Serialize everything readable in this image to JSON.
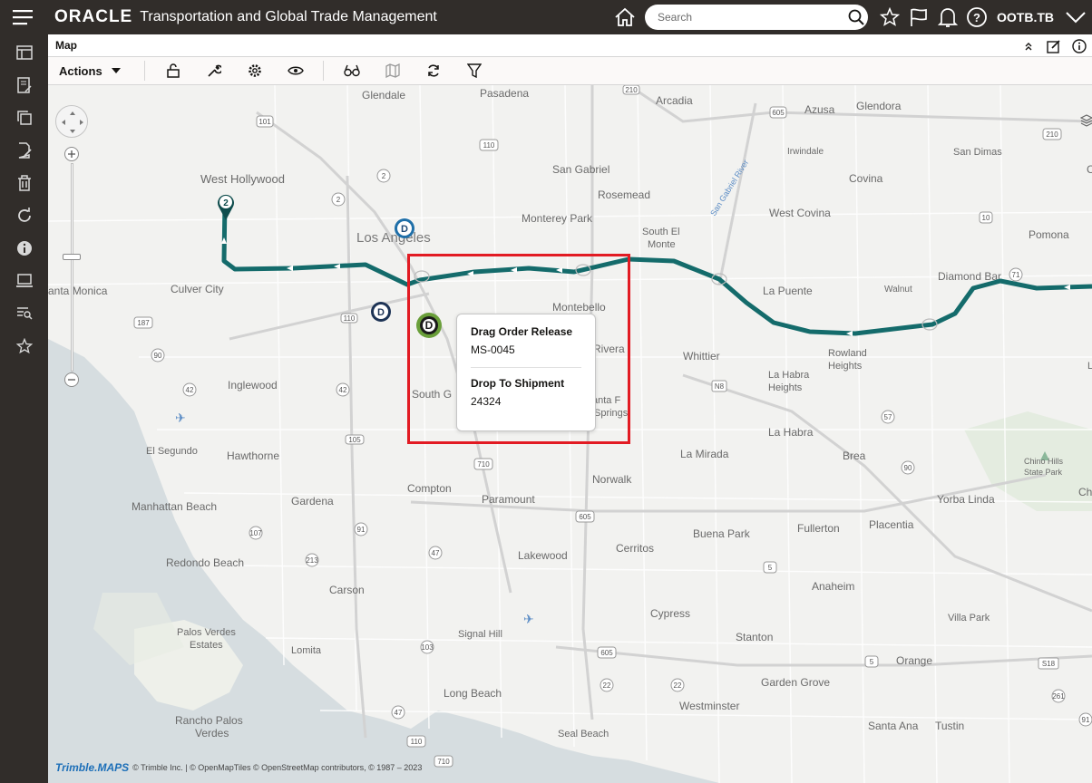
{
  "header": {
    "logo": "ORACLE",
    "app_title": "Transportation and Global Trade Management",
    "search_placeholder": "Search",
    "user": "OOTB.TB"
  },
  "panel": {
    "title": "Map"
  },
  "toolbar": {
    "actions_label": "Actions"
  },
  "map": {
    "places": [
      {
        "name": "Pasadena"
      },
      {
        "name": "Glendale"
      },
      {
        "name": "Arcadia"
      },
      {
        "name": "Azusa"
      },
      {
        "name": "Glendora"
      },
      {
        "name": "West Hollywood"
      },
      {
        "name": "San Gabriel"
      },
      {
        "name": "Rosemead"
      },
      {
        "name": "Irwindale"
      },
      {
        "name": "San Dimas"
      },
      {
        "name": "Covina"
      },
      {
        "name": "Clare"
      },
      {
        "name": "Los Angeles"
      },
      {
        "name": "Monterey Park"
      },
      {
        "name": "West Covina"
      },
      {
        "name": "South El"
      },
      {
        "name": "Monte"
      },
      {
        "name": "Pomona"
      },
      {
        "name": "anta Monica"
      },
      {
        "name": "Culver City"
      },
      {
        "name": "Diamond Bar"
      },
      {
        "name": "Montebello"
      },
      {
        "name": "La Puente"
      },
      {
        "name": "Walnut"
      },
      {
        "name": "Rivera"
      },
      {
        "name": "Whittier"
      },
      {
        "name": "Rowland"
      },
      {
        "name": "Heights"
      },
      {
        "name": "Inglewood"
      },
      {
        "name": "South G"
      },
      {
        "name": "anta F"
      },
      {
        "name": "Springs"
      },
      {
        "name": "La Habra"
      },
      {
        "name": "Heights"
      },
      {
        "name": "Los"
      },
      {
        "name": "La Habra"
      },
      {
        "name": "El Segundo"
      },
      {
        "name": "Hawthorne"
      },
      {
        "name": "La Mirada"
      },
      {
        "name": "Brea"
      },
      {
        "name": "Chino Hills"
      },
      {
        "name": "State Park"
      },
      {
        "name": "Norwalk"
      },
      {
        "name": "Compton"
      },
      {
        "name": "Chino H"
      },
      {
        "name": "Manhattan Beach"
      },
      {
        "name": "Gardena"
      },
      {
        "name": "Paramount"
      },
      {
        "name": "Yorba Linda"
      },
      {
        "name": "Fullerton"
      },
      {
        "name": "Placentia"
      },
      {
        "name": "Buena Park"
      },
      {
        "name": "Cerritos"
      },
      {
        "name": "Lakewood"
      },
      {
        "name": "Redondo Beach"
      },
      {
        "name": "Anaheim"
      },
      {
        "name": "Carson"
      },
      {
        "name": "Cypress"
      },
      {
        "name": "Villa Park"
      },
      {
        "name": "Palos Verdes"
      },
      {
        "name": "Estates"
      },
      {
        "name": "Lomita"
      },
      {
        "name": "Signal Hill"
      },
      {
        "name": "Stanton"
      },
      {
        "name": "Orange"
      },
      {
        "name": "Garden Grove"
      },
      {
        "name": "Long Beach"
      },
      {
        "name": "Westminster"
      },
      {
        "name": "Rancho Palos"
      },
      {
        "name": "Verdes"
      },
      {
        "name": "Santa Ana"
      },
      {
        "name": "Tustin"
      },
      {
        "name": "Seal Beach"
      },
      {
        "name": "San Gabriel River"
      }
    ],
    "shields": [
      "101",
      "2",
      "110",
      "2",
      "210",
      "605",
      "210",
      "10",
      "71",
      "110",
      "187",
      "90",
      "42",
      "42",
      "105",
      "N8",
      "57",
      "710",
      "90",
      "605",
      "107",
      "91",
      "213",
      "47",
      "5",
      "103",
      "405",
      "605",
      "22",
      "22",
      "5",
      "S18",
      "261",
      "91",
      "47",
      "710",
      "110"
    ],
    "marker_stop": "2",
    "marker_d": "D",
    "credit_brand": "Trimble.MAPS",
    "credit_text": "© Trimble Inc. | © OpenMapTiles © OpenStreetMap contributors, © 1987 – 2023"
  },
  "popup": {
    "label1": "Drag Order Release",
    "value1": "MS-0045",
    "label2": "Drop To Shipment",
    "value2": "24324"
  }
}
